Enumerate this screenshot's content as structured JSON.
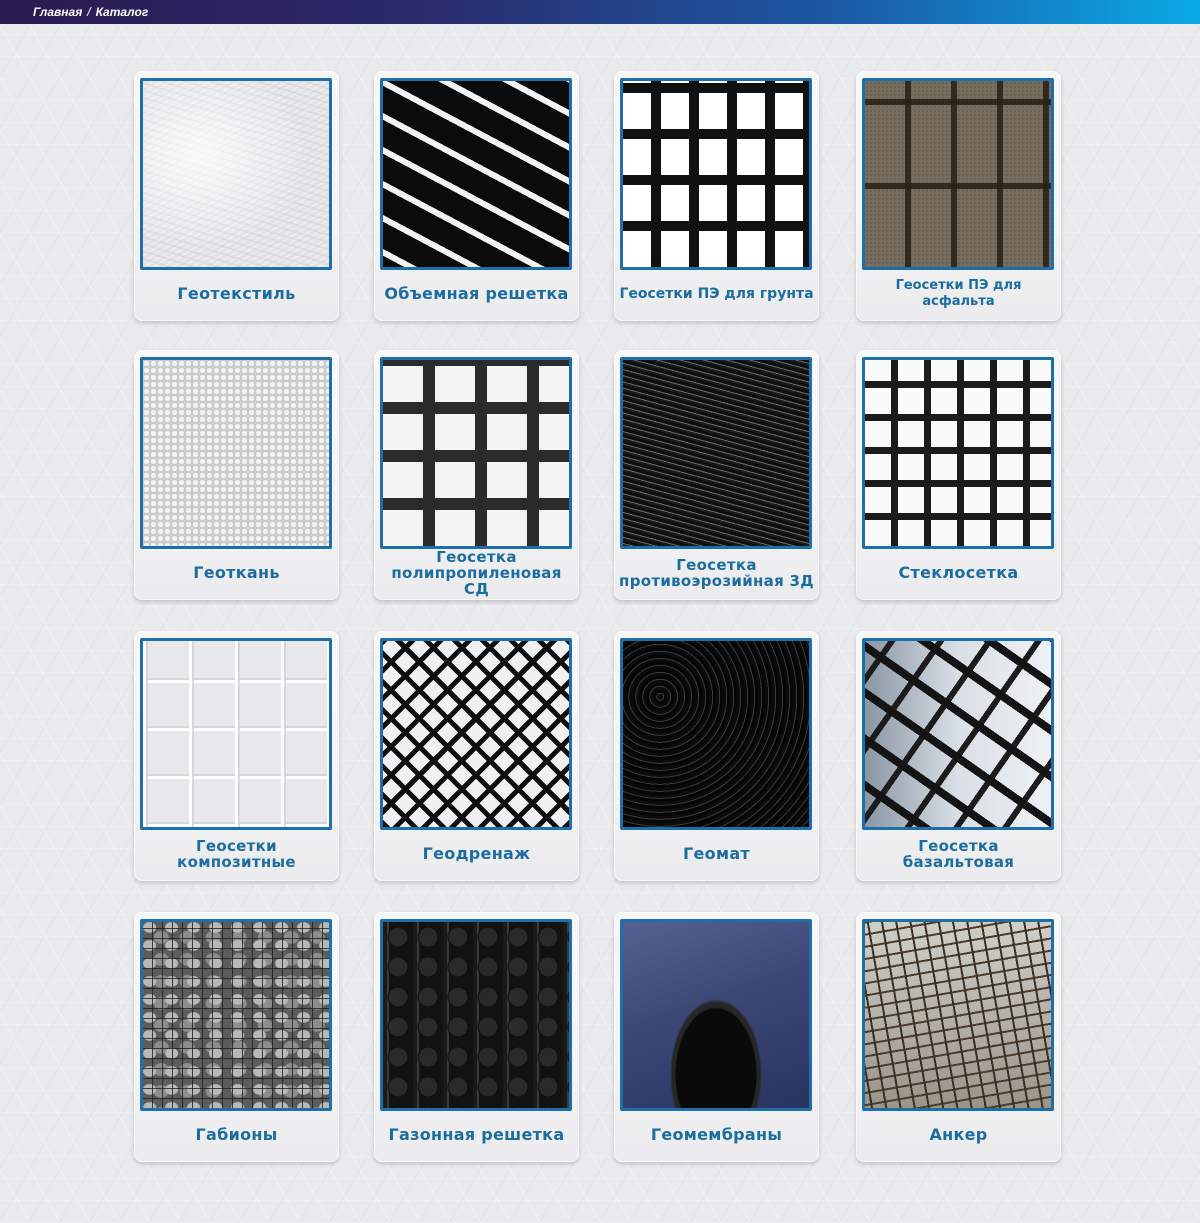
{
  "breadcrumb": {
    "home": "Главная",
    "separator": "/",
    "current": "Каталог"
  },
  "catalog": {
    "items": [
      {
        "label": "Геотекстиль",
        "icon": "geotextile-image"
      },
      {
        "label": "Объемная решетка",
        "icon": "volume-grid-image"
      },
      {
        "label": "Геосетки ПЭ для грунта",
        "icon": "pe-soil-geogrid-image"
      },
      {
        "label": "Геосетки ПЭ для асфальта",
        "icon": "pe-asphalt-geogrid-image"
      },
      {
        "label": "Геоткань",
        "icon": "geofabric-image"
      },
      {
        "label": "Геосетка полипропиленовая СД",
        "icon": "pp-geogrid-image"
      },
      {
        "label": "Геосетка противоэрозийная 3Д",
        "icon": "anti-erosion-geogrid-image"
      },
      {
        "label": "Стеклосетка",
        "icon": "fiberglass-mesh-image"
      },
      {
        "label": "Геосетки композитные",
        "icon": "composite-geogrid-image"
      },
      {
        "label": "Геодренаж",
        "icon": "geodrainage-image"
      },
      {
        "label": "Геомат",
        "icon": "geomat-image"
      },
      {
        "label": "Геосетка базальтовая",
        "icon": "basalt-geogrid-image"
      },
      {
        "label": "Габионы",
        "icon": "gabions-image"
      },
      {
        "label": "Газонная решетка",
        "icon": "lawn-grid-image"
      },
      {
        "label": "Геомембраны",
        "icon": "geomembrane-image"
      },
      {
        "label": "Анкер",
        "icon": "anchor-image"
      }
    ]
  },
  "colors": {
    "accent": "#1a6d9e",
    "frame": "#1c6fa8",
    "topbar_start": "#2a1b4f",
    "topbar_end": "#0aa9e6"
  }
}
